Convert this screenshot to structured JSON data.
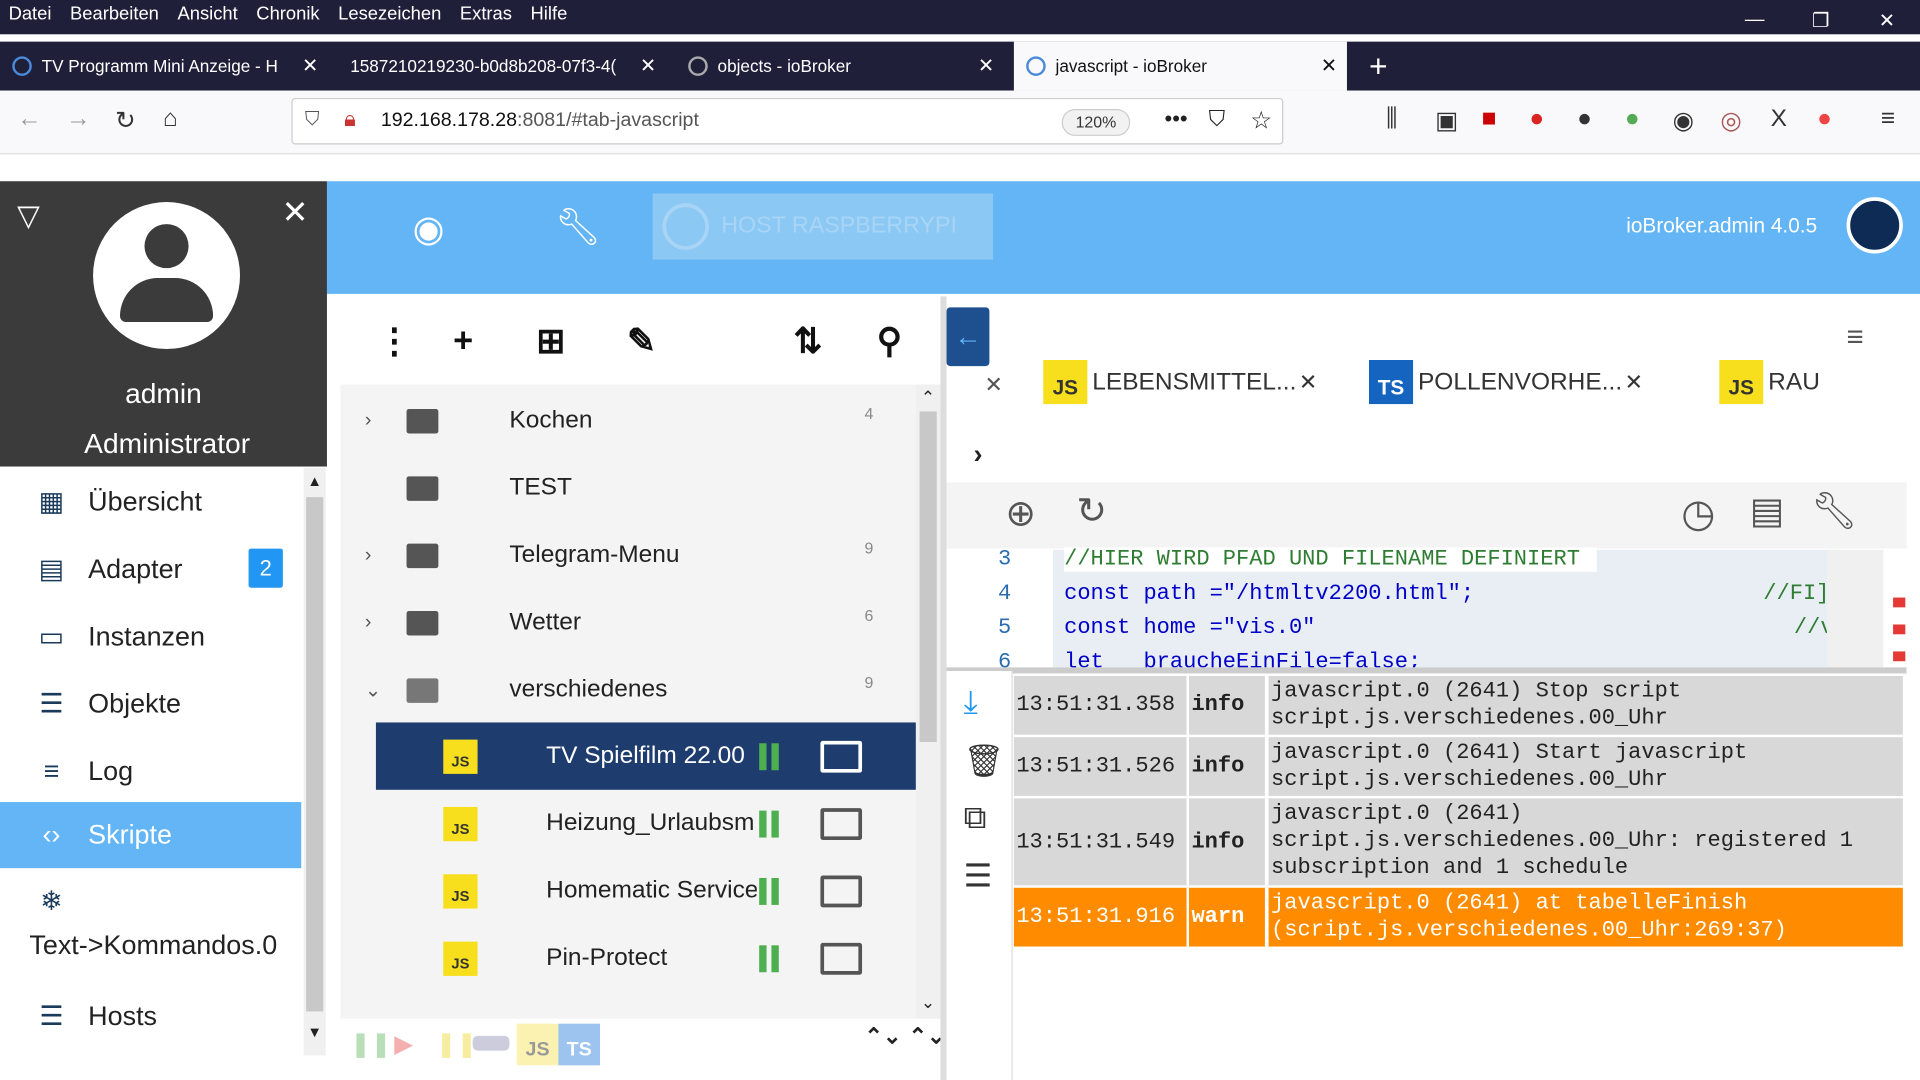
{
  "browser": {
    "menu": [
      "Datei",
      "Bearbeiten",
      "Ansicht",
      "Chronik",
      "Lesezeichen",
      "Extras",
      "Hilfe"
    ],
    "tabs": [
      {
        "title": "TV Programm Mini Anzeige - H"
      },
      {
        "title": "1587210219230-b0d8b208-07f3-4("
      },
      {
        "title": "objects - ioBroker"
      },
      {
        "title": "javascript - ioBroker"
      }
    ],
    "url_host": "192.168.178.28",
    "url_rest": ":8081/#tab-javascript",
    "zoom": "120%"
  },
  "header": {
    "host": "HOST RASPBERRYPI",
    "version": "ioBroker.admin 4.0.5"
  },
  "user": {
    "name": "admin",
    "role": "Administrator"
  },
  "sidebar": {
    "items": [
      {
        "label": "Übersicht",
        "icon": "grid-icon"
      },
      {
        "label": "Adapter",
        "icon": "store-icon",
        "badge": "2"
      },
      {
        "label": "Instanzen",
        "icon": "instances-icon"
      },
      {
        "label": "Objekte",
        "icon": "list-icon"
      },
      {
        "label": "Log",
        "icon": "menu-icon"
      },
      {
        "label": "Skripte",
        "icon": "code-icon",
        "selected": true
      },
      {
        "label": "Text->Kommandos.0",
        "icon": "snowflake-icon"
      },
      {
        "label": "Hosts",
        "icon": "hosts-icon"
      }
    ]
  },
  "tree": {
    "folders": [
      {
        "label": "Kochen",
        "count": "4"
      },
      {
        "label": "TEST",
        "count": ""
      },
      {
        "label": "Telegram-Menu",
        "count": "9"
      },
      {
        "label": "Wetter",
        "count": "6"
      },
      {
        "label": "verschiedenes",
        "count": "9"
      }
    ],
    "scripts": [
      {
        "label": "TV Spielfilm 22.00",
        "badge": "JS"
      },
      {
        "label": "Heizung_Urlaubsm",
        "badge": "JS"
      },
      {
        "label": "Homematic Service",
        "badge": "JS"
      },
      {
        "label": "Pin-Protect",
        "badge": "JS"
      }
    ],
    "bottom_js": "JS",
    "bottom_ts": "TS"
  },
  "editor": {
    "tabs": [
      {
        "label": "LEBENSMITTEL...",
        "badge": "JS"
      },
      {
        "label": "POLLENVORHE...",
        "badge": "TS"
      },
      {
        "label": "RAU",
        "badge": "JS"
      }
    ],
    "code": [
      {
        "ln": "3",
        "text": "//HIER WIRD PFAD UND FILENAME DEFINIERT"
      },
      {
        "ln": "4",
        "text": "const path =\"/htmltv2200.html\";"
      },
      {
        "ln": "5",
        "text": "const home =\"vis.0\""
      },
      {
        "ln": "6",
        "text": "let   braucheEinFile=false;"
      }
    ],
    "code_right": [
      "//FI]",
      "//v"
    ]
  },
  "log": [
    {
      "time": "13:51:31.358",
      "sev": "info",
      "msg": "javascript.0 (2641) Stop script script.js.verschiedenes.00_Uhr"
    },
    {
      "time": "13:51:31.526",
      "sev": "info",
      "msg": "javascript.0 (2641) Start javascript script.js.verschiedenes.00_Uhr"
    },
    {
      "time": "13:51:31.549",
      "sev": "info",
      "msg": "javascript.0 (2641) script.js.verschiedenes.00_Uhr: registered 1 subscription and 1 schedule"
    },
    {
      "time": "13:51:31.916",
      "sev": "warn",
      "msg": "javascript.0 (2641) at tabelleFinish (script.js.verschiedenes.00_Uhr:269:37)"
    }
  ],
  "colors": {
    "accent": "#64b5f6",
    "selected": "#1e3d6e",
    "warn": "#ff8c00",
    "chrome": "#1f1f3a"
  }
}
